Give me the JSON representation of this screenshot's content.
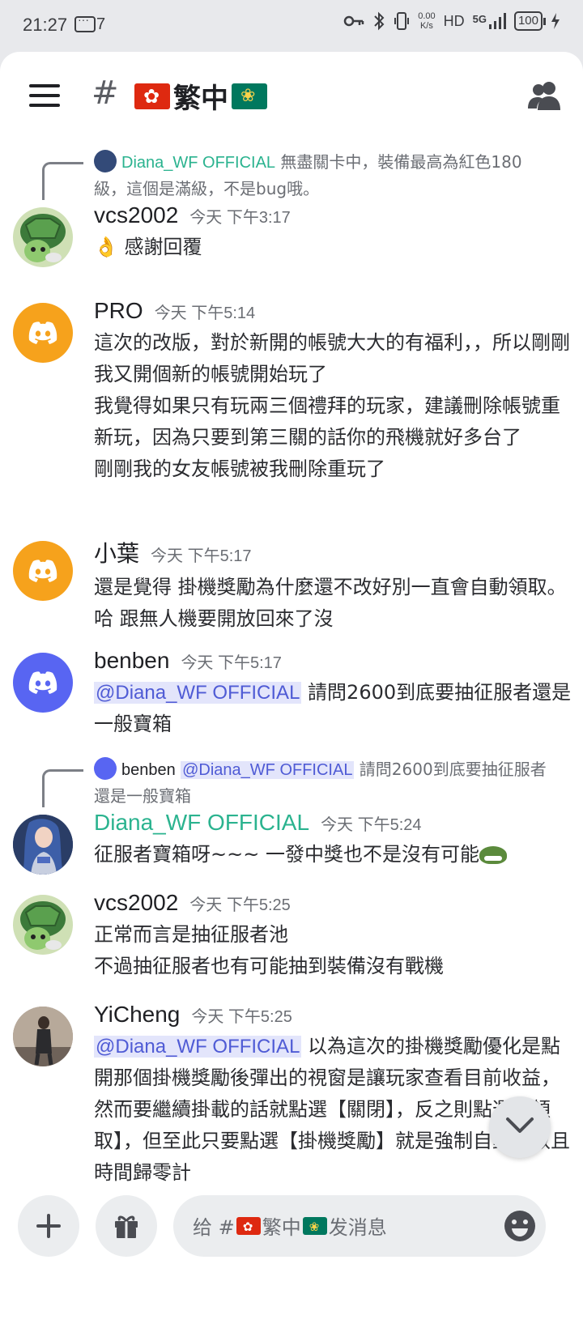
{
  "status_bar": {
    "time": "21:27",
    "notification_count": "7",
    "net_speed_value": "0.00",
    "net_speed_unit": "K/s",
    "hd": "HD",
    "signal": "5G",
    "battery": "100"
  },
  "header": {
    "channel_prefix": "#",
    "channel_name": "繁中"
  },
  "messages": [
    {
      "reply_to_name": "Diana_WF OFFICIAL",
      "reply_to_text": "無盡關卡中，裝備最高為紅色180級，這個是滿級，不是bug哦。",
      "author": "vcs2002",
      "time": "今天 下午3:17",
      "emoji": "👌",
      "text": "感謝回覆"
    },
    {
      "author": "PRO",
      "time": "今天 下午5:14",
      "lines": [
        "這次的改版，對於新開的帳號大大的有福利，，所以剛剛我又開個新的帳號開始玩了",
        "我覺得如果只有玩兩三個禮拜的玩家，建議刪除帳號重新玩，因為只要到第三關的話你的飛機就好多台了",
        "剛剛我的女友帳號被我刪除重玩了"
      ]
    },
    {
      "author": "小葉",
      "time": "今天 下午5:17",
      "text": "還是覺得 掛機獎勵為什麼還不改好別一直會自動領取。哈 跟無人機要開放回來了沒"
    },
    {
      "author": "benben",
      "time": "今天 下午5:17",
      "mention": "@Diana_WF OFFICIAL",
      "text": " 請問2600到底要抽征服者還是一般寶箱"
    },
    {
      "reply_to_name": "benben",
      "reply_mention": "@Diana_WF OFFICIAL",
      "reply_to_text": " 請問2600到底要抽征服者還是一般寶箱",
      "author": "Diana_WF OFFICIAL",
      "time": "今天 下午5:24",
      "text": "征服者寶箱呀~~~ 一發中獎也不是沒有可能"
    },
    {
      "author": "vcs2002",
      "time": "今天 下午5:25",
      "lines": [
        "正常而言是抽征服者池",
        "不過抽征服者也有可能抽到裝備沒有戰機"
      ]
    },
    {
      "author": "YiCheng",
      "time": "今天 下午5:25",
      "mention": "@Diana_WF OFFICIAL",
      "text": " 以為這次的掛機獎勵優化是點開那個掛機獎勵後彈出的視窗是讓玩家查看目前收益，然而要繼續掛載的話就點選【關閉】，反之則點選【領取】，但至此只要點選【掛機獎勵】就是強制自動領取且時間歸零計"
    }
  ],
  "input": {
    "placeholder_prefix": "给 #",
    "placeholder_channel": "繁中",
    "placeholder_suffix": " 发消息"
  }
}
